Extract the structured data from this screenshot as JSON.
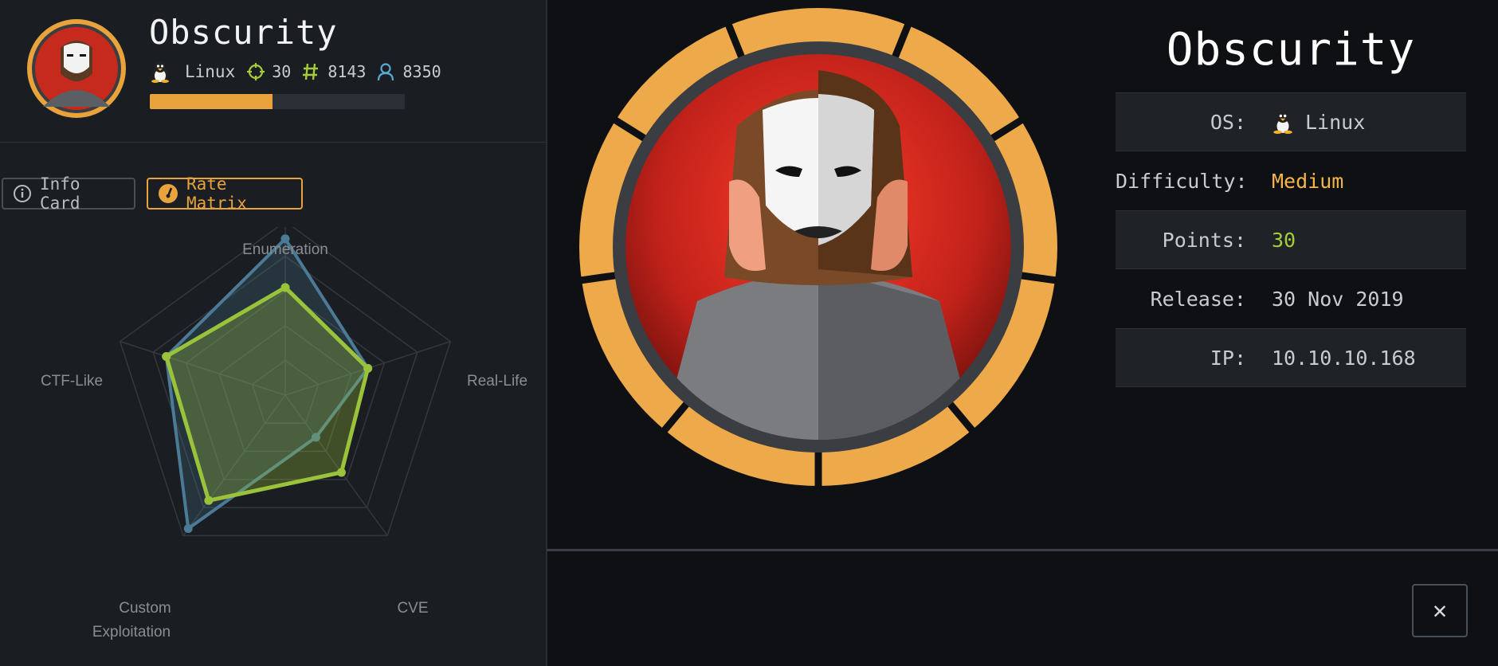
{
  "machine": {
    "name": "Obscurity",
    "os": "Linux",
    "points": "30",
    "user_owns": "8143",
    "root_owns": "8350",
    "progress_fraction": 0.48
  },
  "buttons": {
    "info_card": "Info Card",
    "rate_matrix": "Rate Matrix",
    "close": "✕"
  },
  "radar": {
    "axes": [
      "Enumeration",
      "Real-Life",
      "CVE",
      "Custom",
      "Exploitation",
      "CTF-Like"
    ],
    "series": [
      {
        "color": "#4a7a96",
        "values": [
          0.9,
          0.5,
          0.3,
          0.95,
          0.72
        ]
      },
      {
        "color": "#9ac33b",
        "values": [
          0.62,
          0.5,
          0.55,
          0.75,
          0.72
        ]
      }
    ]
  },
  "info": {
    "rows": [
      {
        "key": "OS:",
        "value": "Linux"
      },
      {
        "key": "Difficulty:",
        "value": "Medium"
      },
      {
        "key": "Points:",
        "value": "30"
      },
      {
        "key": "Release:",
        "value": "30 Nov 2019"
      },
      {
        "key": "IP:",
        "value": "10.10.10.168"
      }
    ]
  },
  "colors": {
    "accent_orange": "#e8a33c",
    "accent_green": "#a4cd39",
    "accent_blue": "#5aa8d6"
  }
}
